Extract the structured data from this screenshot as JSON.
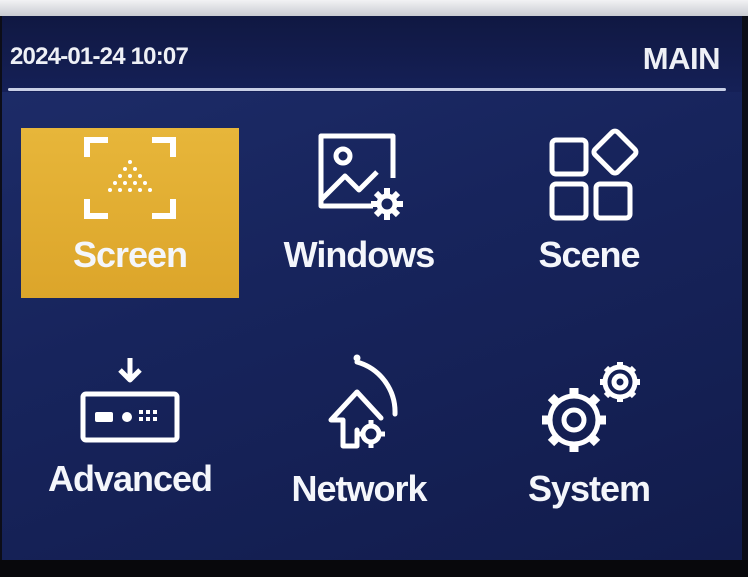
{
  "header": {
    "datetime": "2024-01-24 10:07",
    "page_title": "MAIN"
  },
  "menu": [
    {
      "id": "screen",
      "label": "Screen",
      "icon": "screen-icon",
      "selected": true
    },
    {
      "id": "windows",
      "label": "Windows",
      "icon": "windows-icon",
      "selected": false
    },
    {
      "id": "scene",
      "label": "Scene",
      "icon": "scene-icon",
      "selected": false
    },
    {
      "id": "advanced",
      "label": "Advanced",
      "icon": "advanced-icon",
      "selected": false
    },
    {
      "id": "network",
      "label": "Network",
      "icon": "network-icon",
      "selected": false
    },
    {
      "id": "system",
      "label": "System",
      "icon": "system-icon",
      "selected": false
    }
  ],
  "colors": {
    "background": "#17245c",
    "selected_tile": "#e0aa2e",
    "text": "#f4f6fb"
  }
}
